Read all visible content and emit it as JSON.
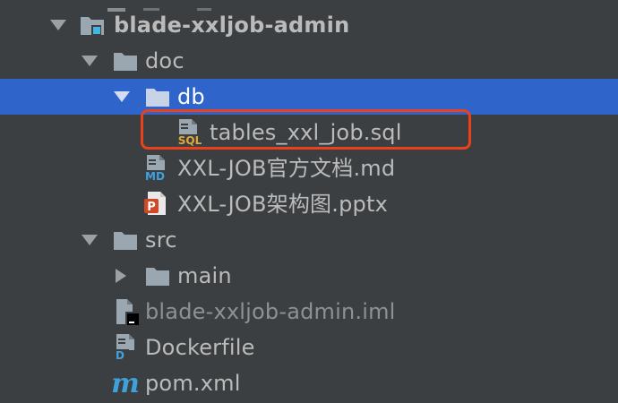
{
  "tree": {
    "items": [
      {
        "label": "blade-xxljob-admin",
        "icon": "module-folder-icon",
        "expanded": true
      },
      {
        "label": "doc",
        "icon": "folder-icon",
        "expanded": true
      },
      {
        "label": "db",
        "icon": "folder-icon",
        "expanded": true,
        "selected": true
      },
      {
        "label": "tables_xxl_job.sql",
        "icon": "sql-file-icon",
        "badge": "SQL"
      },
      {
        "label": "XXL-JOB官方文档.md",
        "icon": "markdown-file-icon",
        "badge": "MD"
      },
      {
        "label": "XXL-JOB架构图.pptx",
        "icon": "powerpoint-file-icon",
        "badge": "P"
      },
      {
        "label": "src",
        "icon": "folder-icon",
        "expanded": true
      },
      {
        "label": "main",
        "icon": "folder-icon",
        "expanded": false
      },
      {
        "label": "blade-xxljob-admin.iml",
        "icon": "iml-file-icon"
      },
      {
        "label": "Dockerfile",
        "icon": "docker-file-icon",
        "badge": "D"
      },
      {
        "label": "pom.xml",
        "icon": "maven-icon",
        "badge": "m"
      }
    ]
  },
  "colors": {
    "background": "#3c3f41",
    "selection": "#2f65ca",
    "highlight_border": "#e8411c",
    "text": "#bbbbbb",
    "dim_text": "#8e9193"
  }
}
